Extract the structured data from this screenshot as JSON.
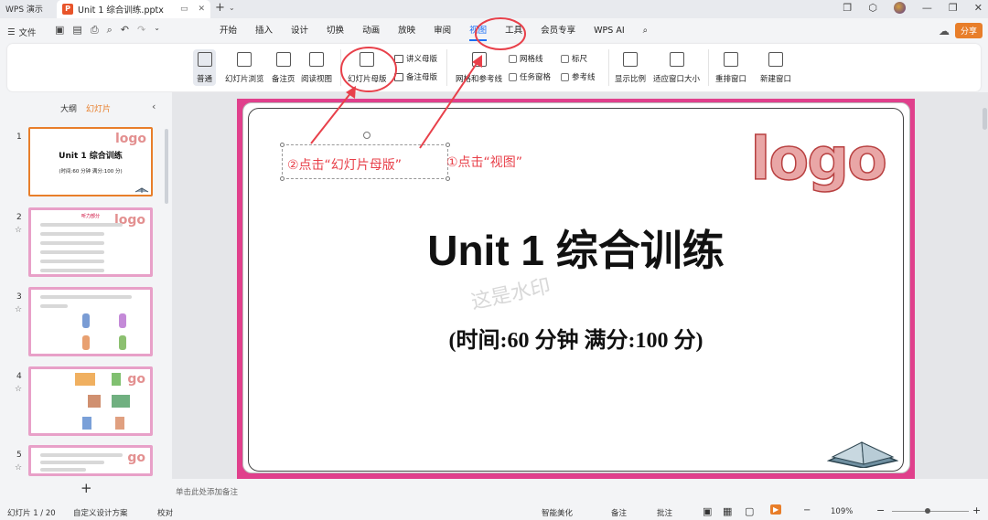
{
  "titlebar": {
    "app_tab": "WPS 演示",
    "doc_tab": "Unit 1 综合训练.pptx",
    "new_tab": "+"
  },
  "menubar": {
    "file": "文件",
    "tabs": [
      "开始",
      "插入",
      "设计",
      "切换",
      "动画",
      "放映",
      "审阅",
      "视图",
      "工具",
      "会员专享",
      "WPS AI"
    ],
    "active_tab": "视图",
    "share": "分享"
  },
  "ribbon": {
    "normal": "普通",
    "slide_sorter": "幻灯片浏览",
    "notes_page": "备注页",
    "reading_view": "阅读视图",
    "slide_master": "幻灯片母版",
    "handout_master": "讲义母版",
    "notes_master": "备注母版",
    "grid_guides": "网格和参考线",
    "gridlines": "网格线",
    "task_pane": "任务窗格",
    "ruler": "标尺",
    "guides": "参考线",
    "zoom": "显示比例",
    "fit_window": "适应窗口大小",
    "arrange_window": "重排窗口",
    "new_window": "新建窗口"
  },
  "left_panel": {
    "tab_outline": "大纲",
    "tab_slides": "幻灯片",
    "slides": [
      {
        "num": "1",
        "logo": "logo",
        "title": "Unit 1 综合训练",
        "sub": "(时间:60 分钟   满分:100 分)"
      },
      {
        "num": "2",
        "logo": "logo",
        "title": "听力部分"
      },
      {
        "num": "3"
      },
      {
        "num": "4",
        "logo": "go"
      },
      {
        "num": "5",
        "logo": "go"
      }
    ]
  },
  "slide": {
    "logo": "logo",
    "title": "Unit 1 综合训练",
    "subtitle": "(时间:60 分钟    满分:100 分)",
    "watermark": "这是水印"
  },
  "annotations": {
    "step1": "①点击“视图”",
    "step2": "②点击“幻灯片母版”",
    "color": "#e8404a"
  },
  "notes_placeholder": "单击此处添加备注",
  "status": {
    "slide_count": "幻灯片 1 / 20",
    "design": "自定义设计方案",
    "proofread": "校对",
    "smart": "智能美化",
    "notes": "备注",
    "comments": "批注",
    "zoom": "109%"
  }
}
